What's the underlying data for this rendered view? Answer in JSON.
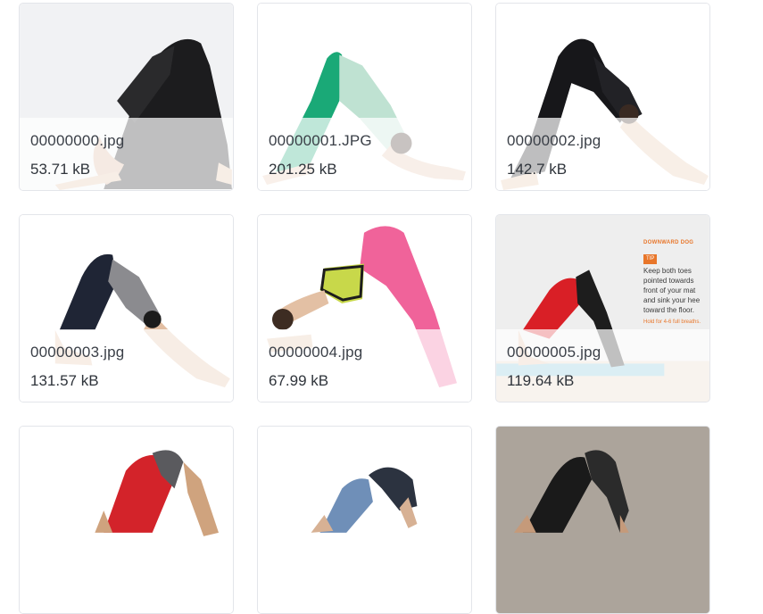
{
  "files": [
    {
      "name": "00000000.jpg",
      "size": "53.71 kB",
      "thumbnail": "yoga-pose-photo"
    },
    {
      "name": "00000001.JPG",
      "size": "201.25 kB",
      "thumbnail": "yoga-pose-photo"
    },
    {
      "name": "00000002.jpg",
      "size": "142.7 kB",
      "thumbnail": "yoga-pose-photo"
    },
    {
      "name": "00000003.jpg",
      "size": "131.57 kB",
      "thumbnail": "yoga-pose-photo"
    },
    {
      "name": "00000004.jpg",
      "size": "67.99 kB",
      "thumbnail": "yoga-pose-photo"
    },
    {
      "name": "00000005.jpg",
      "size": "119.64 kB",
      "thumbnail": "yoga-pose-photo"
    },
    {
      "name": "",
      "size": "",
      "thumbnail": "yoga-pose-photo"
    },
    {
      "name": "",
      "size": "",
      "thumbnail": "yoga-pose-photo"
    },
    {
      "name": "",
      "size": "",
      "thumbnail": "yoga-pose-photo"
    }
  ],
  "card5_infographic": {
    "heading": "DOWNWARD DOG",
    "tag": "TIP",
    "lines": [
      "Keep both toes",
      "pointed towards",
      "front of your mat",
      "and sink your hee",
      "toward the floor."
    ],
    "footer": "Hold for 4-6 full breaths."
  },
  "colors": {
    "card_border": "#e3e5ea",
    "text": "#3a3f47",
    "accent_orange": "#e8762a"
  }
}
